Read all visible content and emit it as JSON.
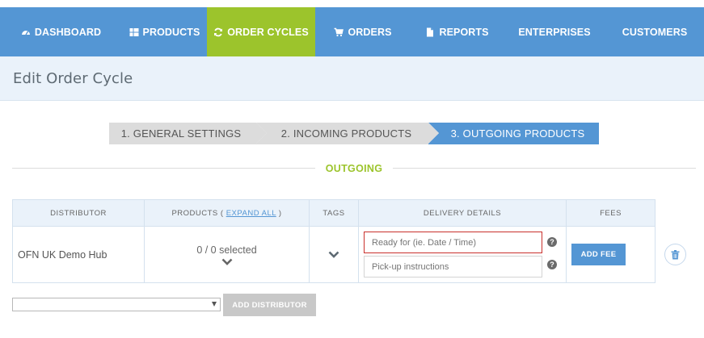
{
  "nav": {
    "items": [
      {
        "label": "DASHBOARD",
        "icon": "dashboard-icon",
        "active": false
      },
      {
        "label": "PRODUCTS",
        "icon": "grid-icon",
        "active": false
      },
      {
        "label": "ORDER CYCLES",
        "icon": "refresh-icon",
        "active": true
      },
      {
        "label": "ORDERS",
        "icon": "cart-icon",
        "active": false
      },
      {
        "label": "REPORTS",
        "icon": "file-icon",
        "active": false
      },
      {
        "label": "ENTERPRISES",
        "icon": "",
        "active": false
      },
      {
        "label": "CUSTOMERS",
        "icon": "",
        "active": false
      }
    ],
    "colors": {
      "bar": "#5496d4",
      "active": "#9cc42c"
    }
  },
  "page": {
    "title": "Edit Order Cycle"
  },
  "steps": [
    {
      "label": "1. GENERAL SETTINGS",
      "active": false
    },
    {
      "label": "2. INCOMING PRODUCTS",
      "active": false
    },
    {
      "label": "3. OUTGOING PRODUCTS",
      "active": true
    }
  ],
  "section": {
    "title": "OUTGOING"
  },
  "table": {
    "headers": {
      "distributor": "DISTRIBUTOR",
      "products_prefix": "PRODUCTS (",
      "expand_all": "EXPAND ALL",
      "products_suffix": ")",
      "tags": "TAGS",
      "delivery": "DELIVERY DETAILS",
      "fees": "FEES"
    },
    "rows": [
      {
        "distributor": "OFN UK Demo Hub",
        "products_selected": "0 / 0 selected",
        "ready_for_placeholder": "Ready for (ie. Date / Time)",
        "pickup_placeholder": "Pick-up instructions",
        "add_fee_label": "ADD FEE"
      }
    ]
  },
  "footer": {
    "select_value": "",
    "add_distributor_label": "ADD DISTRIBUTOR"
  }
}
